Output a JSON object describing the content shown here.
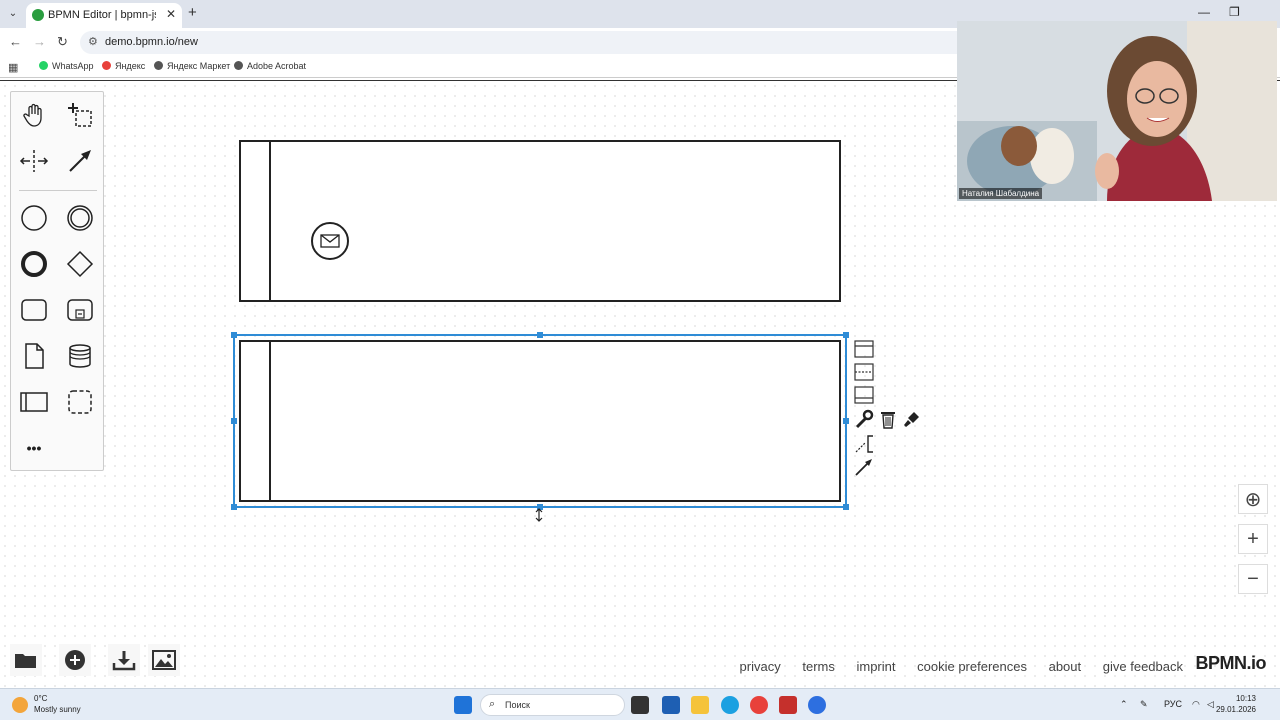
{
  "browser": {
    "tab_title": "BPMN Editor | bpmn-js modeler",
    "url": "demo.bpmn.io/new",
    "bookmarks": [
      "WhatsApp",
      "Яндекс",
      "Яндекс Маркет",
      "Adobe Acrobat"
    ],
    "new_tab_label": "+",
    "close_label": "✕"
  },
  "palette": {
    "tools": [
      "hand-tool",
      "lasso-tool",
      "space-tool",
      "global-connect-tool",
      "start-event",
      "intermediate-event",
      "end-event",
      "gateway",
      "task",
      "subprocess",
      "data-object",
      "data-store",
      "pool",
      "group",
      "more"
    ],
    "more_label": "•••"
  },
  "context_pad": {
    "items": [
      "lane-above",
      "lane-divide",
      "lane-below",
      "change-type",
      "delete",
      "color",
      "connect-text",
      "connect"
    ]
  },
  "footer": {
    "links": [
      "privacy",
      "terms",
      "imprint",
      "cookie preferences",
      "about",
      "give feedback"
    ],
    "logo": "BPMN.io"
  },
  "zoom": {
    "reset": "⊕",
    "in": "+",
    "out": "−"
  },
  "video": {
    "participant_name": "Наталия Шабалдина"
  },
  "taskbar": {
    "weather_temp": "0°C",
    "weather_condition": "Mostly sunny",
    "search_placeholder": "Поиск",
    "language": "РУС",
    "time": "10:13",
    "date": "29.01.2026"
  },
  "colors": {
    "selection": "#2f8cd6",
    "tabstrip": "#dee3ec",
    "taskbar": "#e4ecf6"
  }
}
